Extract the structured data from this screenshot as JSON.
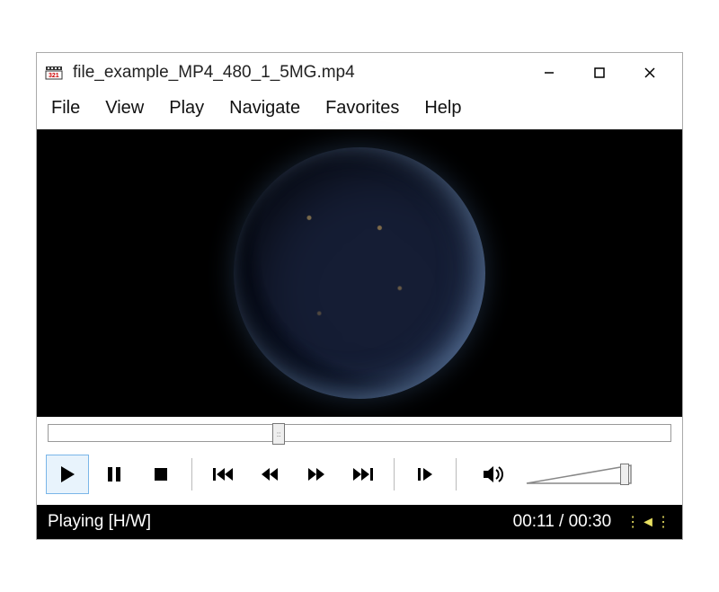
{
  "titlebar": {
    "filename": "file_example_MP4_480_1_5MG.mp4"
  },
  "menu": {
    "items": [
      "File",
      "View",
      "Play",
      "Navigate",
      "Favorites",
      "Help"
    ]
  },
  "seek": {
    "position_percent": 36
  },
  "status": {
    "state": "Playing [H/W]",
    "elapsed": "00:11",
    "total": "00:30",
    "time_display": "00:11 / 00:30"
  },
  "icons": {
    "minimize": "minimize-icon",
    "maximize": "maximize-icon",
    "close": "close-icon",
    "play": "play-icon",
    "pause": "pause-icon",
    "stop": "stop-icon",
    "prev": "skip-back-icon",
    "rw": "rewind-icon",
    "ff": "fast-forward-icon",
    "next": "skip-forward-icon",
    "step": "frame-step-icon",
    "speaker": "speaker-icon",
    "audio_status": "audio-indicator-icon"
  }
}
